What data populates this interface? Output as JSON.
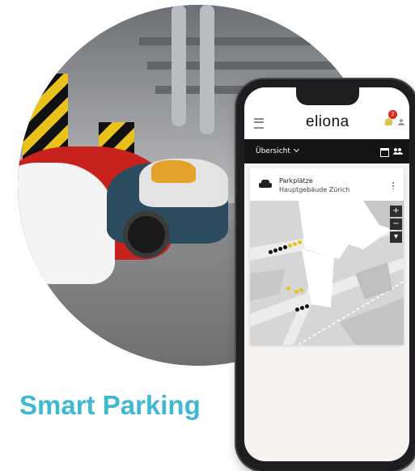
{
  "headline": "Smart Parking",
  "app": {
    "logo": "eliona",
    "notification_count": "2",
    "nav_selected": "Übersicht",
    "card_title": "Parkplätze",
    "card_subtitle": "Hauptgebäude Zürich",
    "zoom_in_label": "+",
    "zoom_out_label": "−",
    "layers_label": "▾"
  },
  "icons": [
    "menu-icon",
    "bell-icon",
    "user-icon",
    "chevron-down-icon",
    "window-icon",
    "people-icon",
    "car-icon",
    "kebab-icon"
  ],
  "colors": {
    "accent": "#3dbad0",
    "notification": "#e2241b",
    "spot_occupied": "#111111",
    "spot_free": "#e8c21a"
  }
}
